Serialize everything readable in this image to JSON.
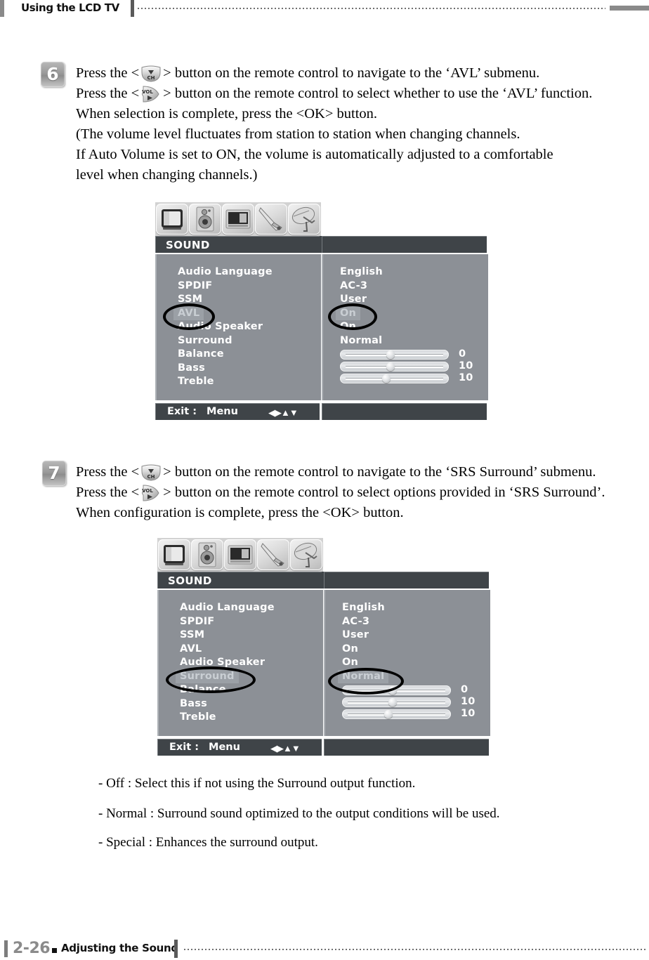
{
  "header": {
    "title": "Using the LCD TV"
  },
  "footer": {
    "page_number": "2-26",
    "section": "Adjusting the Sound"
  },
  "steps": [
    {
      "number": "6",
      "lines": [
        {
          "pre": "Press the <",
          "icon": "ch-down-button-icon",
          "post": "> button on the remote control to navigate to the ‘AVL’ submenu."
        },
        {
          "pre": "Press the <",
          "icon": "vol-right-button-icon",
          "post": "> button on the remote control to select whether to use the ‘AVL’ function."
        },
        {
          "pre": "When selection is complete, press the <OK> button.",
          "icon": "",
          "post": ""
        },
        {
          "pre": "(The volume level fluctuates from station to station when changing channels.",
          "icon": "",
          "post": ""
        },
        {
          "pre": "If Auto Volume is set to ON, the volume is automatically adjusted to a comfortable",
          "icon": "",
          "post": ""
        },
        {
          "pre": "level when changing channels.)",
          "icon": "",
          "post": ""
        }
      ]
    },
    {
      "number": "7",
      "lines": [
        {
          "pre": "Press the <",
          "icon": "ch-down-button-icon",
          "post": "> button on the remote control to navigate to the ‘SRS Surround’ submenu."
        },
        {
          "pre": "Press the <",
          "icon": "vol-right-button-icon",
          "post": "> button on the remote control to select options provided in ‘SRS Surround’."
        },
        {
          "pre": "When configuration is complete, press the <OK> button.",
          "icon": "",
          "post": ""
        }
      ]
    }
  ],
  "osd": {
    "tabs": [
      {
        "name": "picture-tab-icon"
      },
      {
        "name": "sound-tab-icon"
      },
      {
        "name": "screen-tab-icon"
      },
      {
        "name": "setup-tab-icon"
      },
      {
        "name": "antenna-tab-icon"
      }
    ],
    "title": "SOUND",
    "footer_exit": "Exit :",
    "footer_menu": "Menu",
    "footer_arrows": "◀▶▲▼",
    "menu_1": {
      "labels": [
        "Audio Language",
        "SPDIF",
        "SSM",
        "AVL",
        "Audio Speaker",
        "Surround",
        "Balance",
        "Bass",
        "Treble"
      ],
      "selected_label_index": 3,
      "values": [
        "English",
        "AC-3",
        "User",
        "On",
        "On",
        "Normal"
      ],
      "selected_value_index": 3,
      "sliders": [
        {
          "label": "Balance",
          "value": "0",
          "percent": 50
        },
        {
          "label": "Bass",
          "value": "10",
          "percent": 50
        },
        {
          "label": "Treble",
          "value": "10",
          "percent": 46
        }
      ]
    },
    "menu_2": {
      "labels": [
        "Audio Language",
        "SPDIF",
        "SSM",
        "AVL",
        "Audio Speaker",
        "Surround",
        "Balance",
        "Bass",
        "Treble"
      ],
      "selected_label_index": 5,
      "values": [
        "English",
        "AC-3",
        "User",
        "On",
        "On",
        "Normal"
      ],
      "selected_value_index": 5,
      "sliders": [
        {
          "label": "Balance",
          "value": "0",
          "percent": 50
        },
        {
          "label": "Bass",
          "value": "10",
          "percent": 50
        },
        {
          "label": "Treble",
          "value": "10",
          "percent": 46
        }
      ]
    }
  },
  "notes": [
    "- Off : Select this if not using the Surround output function.",
    "- Normal : Surround sound optimized to the output conditions will be used.",
    "- Special : Enhances the surround output."
  ]
}
